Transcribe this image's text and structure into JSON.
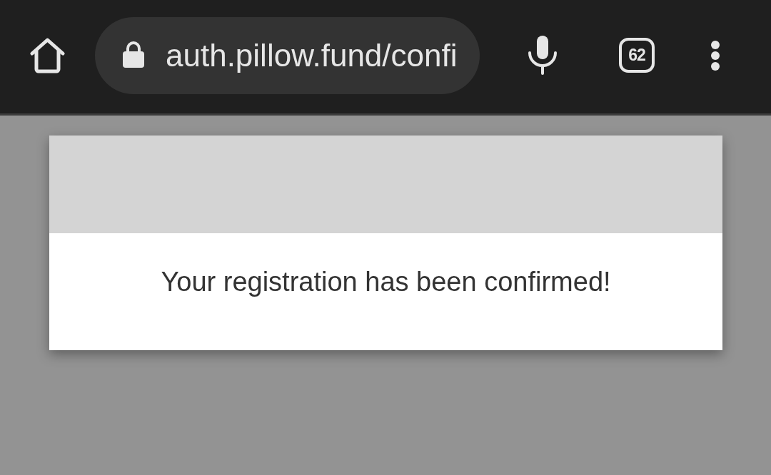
{
  "toolbar": {
    "url": "auth.pillow.fund/confi",
    "tab_count": "62"
  },
  "card": {
    "message": "Your registration has been confirmed!"
  }
}
